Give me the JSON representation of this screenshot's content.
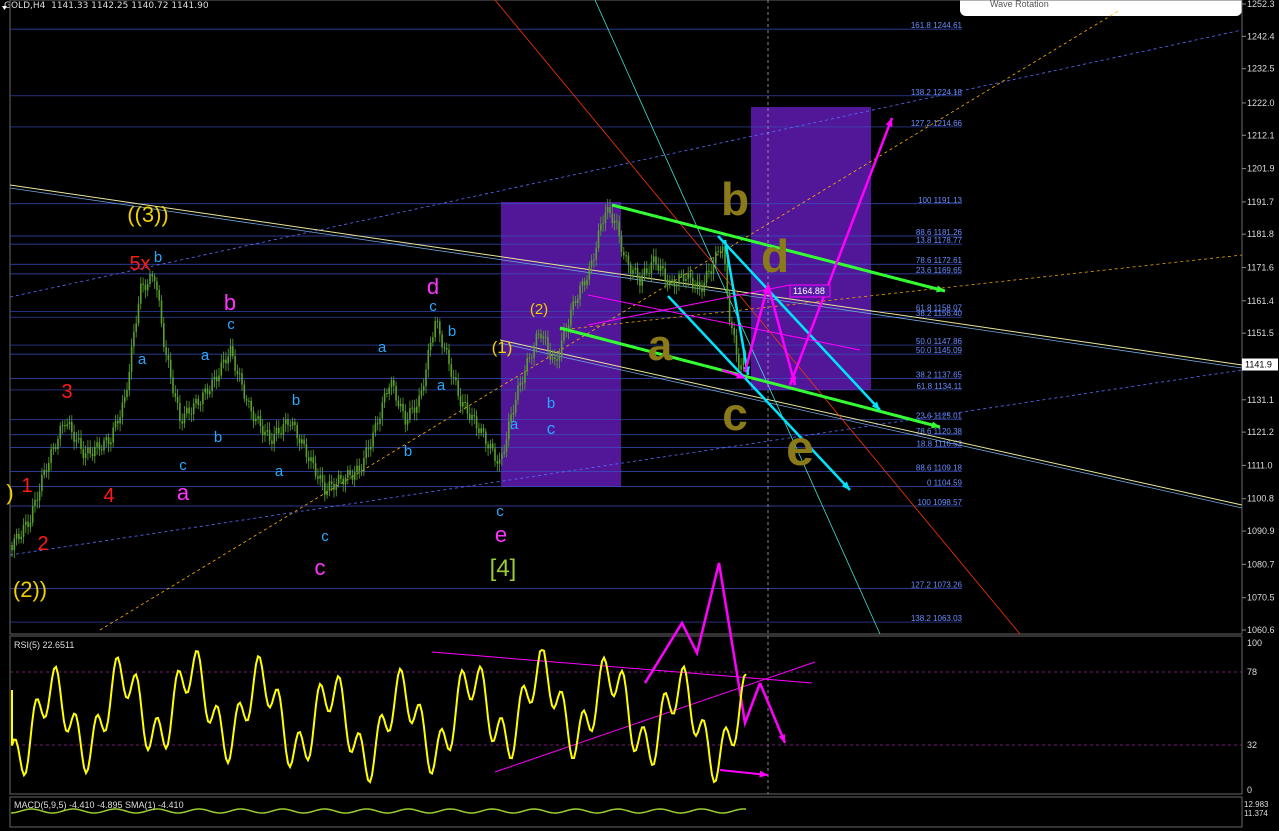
{
  "header": {
    "symbol": "GOLD,H4",
    "ohlc": "1141.33 1142.25 1140.72 1141.90"
  },
  "tooltip_text": "Wave Rotation",
  "price_axis": {
    "ticks": [
      "1252.3",
      "1242.4",
      "1232.5",
      "1222.0",
      "1212.1",
      "1201.9",
      "1191.7",
      "1181.8",
      "1171.6",
      "1161.4",
      "1151.5",
      "1141.3",
      "1131.1",
      "1121.2",
      "1111.0",
      "1100.8",
      "1090.9",
      "1080.7",
      "1070.5",
      "1060.6"
    ],
    "current_price": "1141.9"
  },
  "fib_levels": [
    {
      "label": "161.8 1244.61",
      "price": 1244.61
    },
    {
      "label": "138.2 1224.18",
      "price": 1224.18
    },
    {
      "label": "127.2 1214.66",
      "price": 1214.66
    },
    {
      "label": "100 1191.13",
      "price": 1191.13
    },
    {
      "label": "88.6 1181.26",
      "price": 1181.26
    },
    {
      "label": "13.8 1178.77",
      "price": 1178.77
    },
    {
      "label": "78.6 1172.61",
      "price": 1172.61
    },
    {
      "label": "23.6 1169.65",
      "price": 1169.65
    },
    {
      "label": "61.8 1158.07",
      "price": 1158.07
    },
    {
      "label": "38.2 1156.40",
      "price": 1156.4
    },
    {
      "label": "50.0 1147.86",
      "price": 1147.86
    },
    {
      "label": "50.0 1145.09",
      "price": 1145.09
    },
    {
      "label": "38.2 1137.65",
      "price": 1137.65
    },
    {
      "label": "61.8 1134.11",
      "price": 1134.11
    },
    {
      "label": "23.6 1125.01",
      "price": 1125.01
    },
    {
      "label": "78.6 1120.38",
      "price": 1120.38
    },
    {
      "label": "18.8 1116.53",
      "price": 1116.53
    },
    {
      "label": "88.6 1109.18",
      "price": 1109.18
    },
    {
      "label": "0 1104.59",
      "price": 1104.59
    },
    {
      "label": "100 1098.57",
      "price": 1098.57
    },
    {
      "label": "127.2 1073.26",
      "price": 1073.26
    },
    {
      "label": "138.2 1063.03",
      "price": 1063.03
    }
  ],
  "price_tag": "1164.88",
  "wave_labels": [
    {
      "text": "((3))",
      "color": "#f0d000"
    },
    {
      "text": "5x",
      "color": "#ff1a1a"
    },
    {
      "text": "b",
      "color": "#29a8ff"
    },
    {
      "text": "a",
      "color": "#29a8ff"
    },
    {
      "text": "3",
      "color": "#ff1a1a"
    },
    {
      "text": "1",
      "color": "#ff1a1a"
    },
    {
      "text": "2",
      "color": "#ff1a1a"
    },
    {
      "text": "4",
      "color": "#ff1a1a"
    },
    {
      "text": "(2))",
      "color": "#f0d000"
    },
    {
      "text": ")",
      "color": "#f0d000"
    },
    {
      "text": "b",
      "color": "#ff33ff"
    },
    {
      "text": "c",
      "color": "#29a8ff"
    },
    {
      "text": "a",
      "color": "#29a8ff"
    },
    {
      "text": "b",
      "color": "#29a8ff"
    },
    {
      "text": "c",
      "color": "#29a8ff"
    },
    {
      "text": "a",
      "color": "#ff33ff"
    },
    {
      "text": "b",
      "color": "#29a8ff"
    },
    {
      "text": "a",
      "color": "#29a8ff"
    },
    {
      "text": "c",
      "color": "#29a8ff"
    },
    {
      "text": "c",
      "color": "#ff33ff"
    },
    {
      "text": "a",
      "color": "#29a8ff"
    },
    {
      "text": "b",
      "color": "#29a8ff"
    },
    {
      "text": "d",
      "color": "#ff33ff"
    },
    {
      "text": "c",
      "color": "#29a8ff"
    },
    {
      "text": "b",
      "color": "#29a8ff"
    },
    {
      "text": "a",
      "color": "#29a8ff"
    },
    {
      "text": "c",
      "color": "#29a8ff"
    },
    {
      "text": "e",
      "color": "#ff33ff"
    },
    {
      "text": "[4]",
      "color": "#9acd32"
    },
    {
      "text": "(1)",
      "color": "#f0d000"
    },
    {
      "text": "(2)",
      "color": "#f0d000"
    },
    {
      "text": "a",
      "color": "#29a8ff"
    },
    {
      "text": "b",
      "color": "#29a8ff"
    },
    {
      "text": "c",
      "color": "#29a8ff"
    }
  ],
  "drawn_letters": [
    "b",
    "d",
    "a",
    "c",
    "e"
  ],
  "rsi": {
    "title": "RSI(5) 22.6511",
    "ticks": [
      "100",
      "78",
      "32",
      "0"
    ]
  },
  "macd": {
    "title": "MACD(5,9,5) -4.410 -4.895 SMA(1) -4.410",
    "ticks": [
      "12.983",
      "11.374"
    ]
  },
  "colors": {
    "candle": "#5aa02c",
    "rsi": "#ffff00",
    "magenta": "#ff00ff",
    "cyan": "#00e5ff",
    "green": "#33ff33",
    "purple": "#5a1aa8"
  }
}
